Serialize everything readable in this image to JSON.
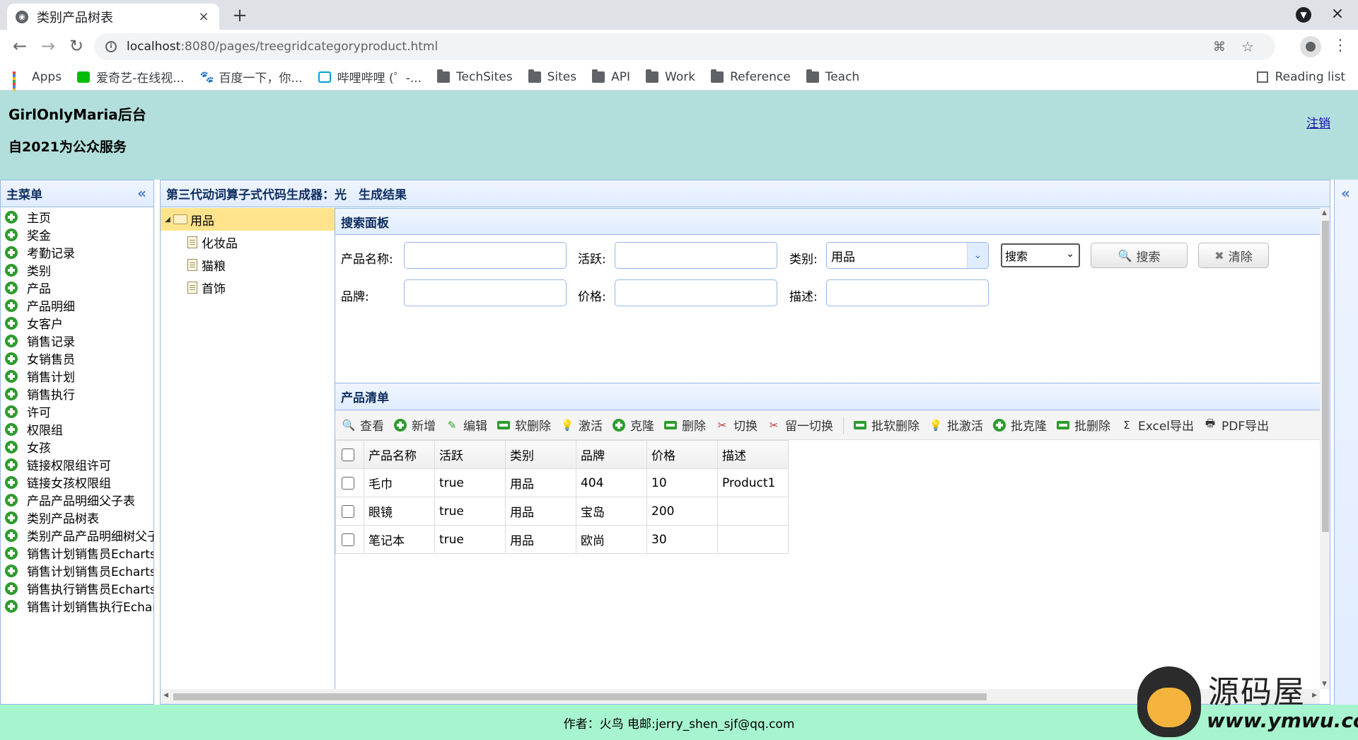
{
  "browser": {
    "tab_title": "类别产品树表",
    "tab_close": "×",
    "new_tab": "+",
    "url_host": "localhost",
    "url_path": ":8080/pages/treegridcategoryproduct.html",
    "bookmarks": [
      "Apps",
      "爱奇艺-在线视...",
      "百度一下，你...",
      "哔哩哔哩 (゜-...",
      "TechSites",
      "Sites",
      "API",
      "Work",
      "Reference",
      "Teach"
    ],
    "reading_list": "Reading list"
  },
  "header": {
    "brand": "GirlOnlyMaria后台",
    "slogan": "自2021为公众服务",
    "logout": "注销"
  },
  "sidebar": {
    "title": "主菜单",
    "collapse": "«",
    "items": [
      "主页",
      "奖金",
      "考勤记录",
      "类别",
      "产品",
      "产品明细",
      "女客户",
      "销售记录",
      "女销售员",
      "销售计划",
      "销售执行",
      "许可",
      "权限组",
      "女孩",
      "链接权限组许可",
      "链接女孩权限组",
      "产品产品明细父子表",
      "类别产品树表",
      "类别产品产品明细树父子表",
      "销售计划销售员Echarts",
      "销售计划销售员Echarts",
      "销售执行销售员Echarts",
      "销售计划销售执行Echarts"
    ]
  },
  "east": {
    "expand": "«"
  },
  "center": {
    "title": "第三代动词算子式代码生成器：光　生成结果"
  },
  "tree": {
    "root": "用品",
    "root_toggle": "◢",
    "children": [
      "化妆品",
      "猫粮",
      "首饰"
    ]
  },
  "search": {
    "title": "搜索面板",
    "labels": {
      "name": "产品名称:",
      "active": "活跃:",
      "category": "类别:",
      "brand": "品牌:",
      "price": "价格:",
      "desc": "描述:"
    },
    "values": {
      "name": "",
      "active": "",
      "brand": "",
      "price": "",
      "desc": ""
    },
    "category_value": "用品",
    "combo_arrow": "⌄",
    "mode_select": "搜索",
    "mode_chevron": "⌄",
    "search_btn": "搜索",
    "clear_btn": "清除",
    "search_icon": "🔍",
    "clear_icon": "✖"
  },
  "list": {
    "title": "产品清单",
    "toolbar": [
      "查看",
      "新增",
      "编辑",
      "软删除",
      "激活",
      "克隆",
      "删除",
      "切换",
      "留一切换",
      "批软删除",
      "批激活",
      "批克隆",
      "批删除",
      "Excel导出",
      "PDF导出"
    ],
    "toolbar_glyphs": {
      "view": "🔍",
      "edit": "✎",
      "activate": "💡",
      "toggle": "✂",
      "sigma": "Σ",
      "pdf": "🖶"
    },
    "columns": [
      "产品名称",
      "活跃",
      "类别",
      "品牌",
      "价格",
      "描述"
    ],
    "rows": [
      [
        "毛巾",
        "true",
        "用品",
        "404",
        "10",
        "Product1"
      ],
      [
        "眼镜",
        "true",
        "用品",
        "宝岛",
        "200",
        ""
      ],
      [
        "笔记本",
        "true",
        "用品",
        "欧尚",
        "30",
        ""
      ]
    ]
  },
  "footer": {
    "text": "作者：火鸟 电邮:jerry_shen_sjf@qq.com"
  },
  "watermark": {
    "big": "源码屋",
    "small": "www.ymwu.com"
  }
}
